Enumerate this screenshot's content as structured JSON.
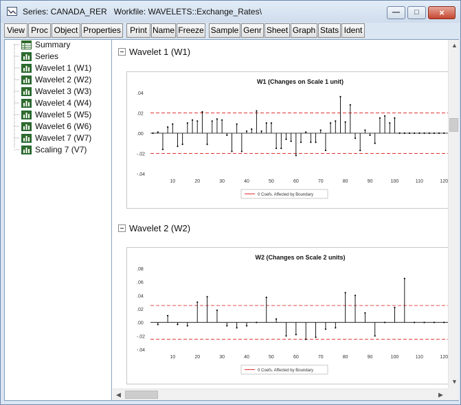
{
  "window": {
    "title": "Series: CANADA_RER   Workfile: WAVELETS::Exchange_Rates\\",
    "minimize_label": "—",
    "maximize_label": "□",
    "close_label": "×"
  },
  "toolbar": {
    "buttons": [
      "View",
      "Proc",
      "Object",
      "Properties",
      "Print",
      "Name",
      "Freeze",
      "Sample",
      "Genr",
      "Sheet",
      "Graph",
      "Stats",
      "Ident"
    ]
  },
  "tree": {
    "items": [
      {
        "label": "Summary",
        "icon": "table-icon"
      },
      {
        "label": "Series",
        "icon": "series-icon"
      },
      {
        "label": "Wavelet 1 (W1)",
        "icon": "series-icon"
      },
      {
        "label": "Wavelet 2 (W2)",
        "icon": "series-icon"
      },
      {
        "label": "Wavelet 3 (W3)",
        "icon": "series-icon"
      },
      {
        "label": "Wavelet 4 (W4)",
        "icon": "series-icon"
      },
      {
        "label": "Wavelet 5 (W5)",
        "icon": "series-icon"
      },
      {
        "label": "Wavelet 6 (W6)",
        "icon": "series-icon"
      },
      {
        "label": "Wavelet 7 (W7)",
        "icon": "series-icon"
      },
      {
        "label": "Scaling 7 (V7)",
        "icon": "series-icon"
      }
    ]
  },
  "sections": [
    {
      "title": "Wavelet 1 (W1)"
    },
    {
      "title": "Wavelet 2 (W2)"
    }
  ],
  "chart_data": [
    {
      "type": "line",
      "title": "W1 (Changes on Scale 1 unit)",
      "ylim": [
        -0.04,
        0.04
      ],
      "yticks": [
        ".04",
        ".02",
        ".00",
        "-.02",
        "-.04"
      ],
      "xticks": [
        "10",
        "20",
        "30",
        "40",
        "50",
        "60",
        "70",
        "80",
        "90",
        "100",
        "110",
        "120"
      ],
      "xlim": [
        1,
        128
      ],
      "reference_lines": [
        0.02,
        -0.02
      ],
      "legend": "0 Coefs. Affected by Boundary",
      "series_color": "#000000",
      "reference_color": "#e03030",
      "x": [
        2,
        4,
        6,
        8,
        10,
        12,
        14,
        16,
        18,
        20,
        22,
        24,
        26,
        28,
        30,
        32,
        34,
        36,
        38,
        40,
        42,
        44,
        46,
        48,
        50,
        52,
        54,
        56,
        58,
        60,
        62,
        64,
        66,
        68,
        70,
        72,
        74,
        76,
        78,
        80,
        82,
        84,
        86,
        88,
        90,
        92,
        94,
        96,
        98,
        100,
        102,
        104,
        106,
        108,
        110,
        112,
        114,
        116,
        118,
        120,
        122,
        124,
        126,
        128
      ],
      "values": [
        0.0,
        0.001,
        -0.016,
        0.006,
        0.009,
        -0.013,
        -0.011,
        0.01,
        0.013,
        0.012,
        0.021,
        -0.011,
        0.012,
        0.014,
        0.013,
        -0.002,
        -0.018,
        0.009,
        -0.018,
        0.002,
        0.004,
        0.022,
        0.002,
        0.01,
        0.01,
        -0.015,
        -0.015,
        -0.006,
        -0.008,
        -0.022,
        -0.009,
        0.001,
        -0.009,
        -0.009,
        0.003,
        -0.017,
        0.01,
        0.012,
        0.036,
        0.011,
        0.028,
        -0.005,
        -0.017,
        0.003,
        -0.002,
        -0.01,
        0.015,
        0.017,
        0.01,
        0.015,
        0.0,
        0.0,
        0.0,
        0.0,
        0.0,
        0.0,
        0.0,
        0.0,
        0.0,
        0.0,
        0.0,
        0.0,
        0.0,
        0.0
      ]
    },
    {
      "type": "line",
      "title": "W2 (Changes on Scale 2 units)",
      "ylim": [
        -0.04,
        0.08
      ],
      "yticks": [
        ".08",
        ".06",
        ".04",
        ".02",
        ".00",
        "-.02",
        "-.04"
      ],
      "xticks": [
        "10",
        "20",
        "30",
        "40",
        "50",
        "60",
        "70",
        "80",
        "90",
        "100",
        "110",
        "120"
      ],
      "xlim": [
        1,
        128
      ],
      "reference_lines": [
        0.025,
        -0.025
      ],
      "legend": "0 Coefs. Affected by Boundary",
      "series_color": "#000000",
      "reference_color": "#e03030",
      "x": [
        4,
        8,
        12,
        16,
        20,
        24,
        28,
        32,
        36,
        40,
        44,
        48,
        52,
        56,
        60,
        64,
        68,
        72,
        76,
        80,
        84,
        88,
        92,
        96,
        100,
        104,
        108,
        112,
        116,
        120,
        124,
        128
      ],
      "values": [
        -0.003,
        0.01,
        -0.003,
        -0.005,
        0.03,
        0.038,
        0.018,
        -0.005,
        -0.008,
        -0.005,
        0.0,
        0.037,
        0.005,
        -0.02,
        -0.018,
        -0.025,
        -0.022,
        -0.01,
        -0.008,
        0.044,
        0.04,
        0.014,
        -0.02,
        0.0,
        0.022,
        0.065,
        0.0,
        0.0,
        0.0,
        0.0,
        0.0,
        0.0
      ]
    }
  ]
}
